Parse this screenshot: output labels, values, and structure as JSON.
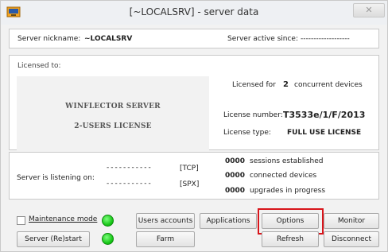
{
  "window": {
    "title": "[~LOCALSRV] - server data",
    "close_glyph": "✕"
  },
  "server": {
    "nickname_label": "Server nickname:",
    "nickname_value": "~LOCALSRV",
    "active_since_label": "Server active since:",
    "active_since_value": "-------------------"
  },
  "license": {
    "licensed_to_label": "Licensed to:",
    "logo_line1": "WINFLECTOR SERVER",
    "logo_line2": "2-USERS LICENSE",
    "licensed_for_prefix": "Licensed for",
    "licensed_for_count": "2",
    "licensed_for_suffix": "concurrent devices",
    "number_label": "License number:",
    "number_value": "T3533e/1/F/2013",
    "type_label": "License type:",
    "type_value": "FULL USE LICENSE"
  },
  "listening": {
    "label": "Server is listening on:",
    "tcp_value": "-----------",
    "tcp_tag": "[TCP]",
    "spx_value": "-----------",
    "spx_tag": "[SPX]"
  },
  "stats": {
    "sessions_count": "0000",
    "sessions_label": "sessions established",
    "devices_count": "0000",
    "devices_label": "connected devices",
    "upgrades_count": "0000",
    "upgrades_label": "upgrades in progress"
  },
  "controls": {
    "maintenance_label": "Maintenance mode",
    "maintenance_led_color": "#22cc22",
    "restart_label": "Server (Re)start",
    "restart_led_color": "#22cc22",
    "users_accounts_label": "Users accounts",
    "farm_label": "Farm",
    "applications_label": "Applications",
    "options_label": "Options",
    "monitor_label": "Monitor",
    "refresh_label": "Refresh",
    "disconnect_label": "Disconnect"
  },
  "colors": {
    "highlight": "#d8151b"
  }
}
